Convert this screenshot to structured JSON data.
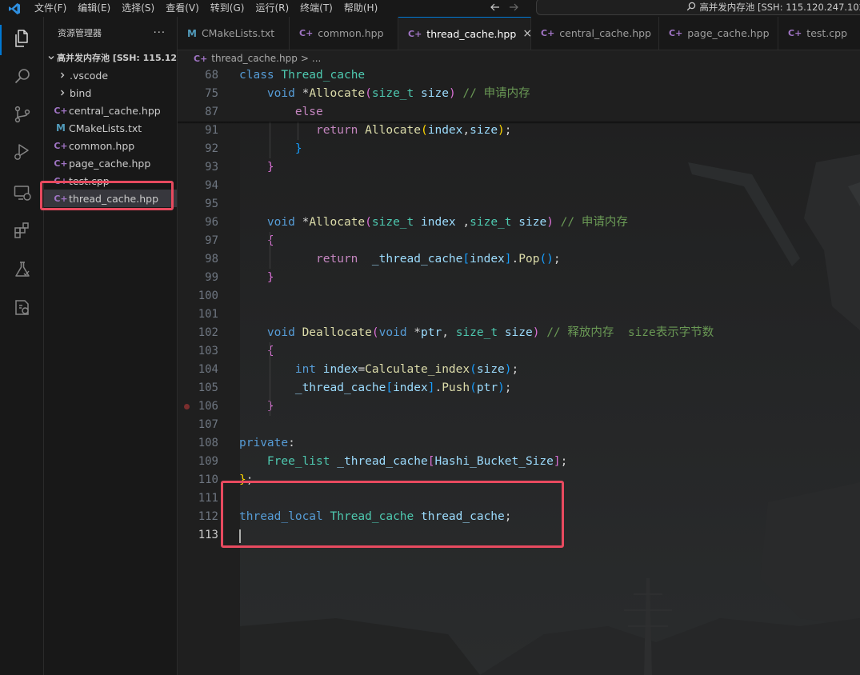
{
  "titlebar": {
    "menu": [
      "文件(F)",
      "编辑(E)",
      "选择(S)",
      "查看(V)",
      "转到(G)",
      "运行(R)",
      "终端(T)",
      "帮助(H)"
    ],
    "command_center": "高并发内存池 [SSH: 115.120.247.102"
  },
  "activity_bar": {
    "icons": [
      "explorer-icon",
      "search-icon",
      "source-control-icon",
      "run-debug-icon",
      "remote-explorer-icon",
      "extensions-icon",
      "testing-icon",
      "cmake-tools-icon"
    ]
  },
  "sidebar": {
    "title": "资源管理器",
    "more": "···",
    "folder": "高并发内存池 [SSH: 115.12...",
    "items": [
      {
        "label": ".vscode",
        "kind": "folder"
      },
      {
        "label": "bind",
        "kind": "folder"
      },
      {
        "label": "central_cache.hpp",
        "kind": "cpp"
      },
      {
        "label": "CMakeLists.txt",
        "kind": "cmake"
      },
      {
        "label": "common.hpp",
        "kind": "cpp"
      },
      {
        "label": "page_cache.hpp",
        "kind": "cpp"
      },
      {
        "label": "test.cpp",
        "kind": "cpp"
      },
      {
        "label": "thread_cache.hpp",
        "kind": "cpp",
        "selected": true
      }
    ]
  },
  "tabs": [
    {
      "label": "CMakeLists.txt",
      "icon": "cmake"
    },
    {
      "label": "common.hpp",
      "icon": "cpp"
    },
    {
      "label": "thread_cache.hpp",
      "icon": "cpp",
      "active": true,
      "close": "×"
    },
    {
      "label": "central_cache.hpp",
      "icon": "cpp"
    },
    {
      "label": "page_cache.hpp",
      "icon": "cpp"
    },
    {
      "label": "test.cpp",
      "icon": "cpp"
    }
  ],
  "breadcrumb": {
    "file": "thread_cache.hpp",
    "separator": ">",
    "rest": "..."
  },
  "editor": {
    "current_line": "113",
    "breakpoint_line": "106",
    "lines": [
      {
        "n": "68",
        "tokens": [
          [
            "kw",
            "class"
          ],
          [
            "pu",
            " "
          ],
          [
            "ty",
            "Thread_cache"
          ]
        ]
      },
      {
        "n": "75",
        "tokens": [
          [
            "pu",
            "    "
          ],
          [
            "kw",
            "void"
          ],
          [
            "pu",
            " *"
          ],
          [
            "fn",
            "Allocate"
          ],
          [
            "br2",
            "("
          ],
          [
            "ty",
            "size_t"
          ],
          [
            "pu",
            " "
          ],
          [
            "va",
            "size"
          ],
          [
            "br2",
            ")"
          ],
          [
            "pu",
            " "
          ],
          [
            "cm",
            "// 申请内存"
          ]
        ]
      },
      {
        "n": "87",
        "tokens": [
          [
            "pu",
            "        "
          ],
          [
            "ct",
            "else"
          ]
        ]
      },
      {
        "n": "91",
        "tokens": [
          [
            "pu",
            "           "
          ],
          [
            "ct",
            "return"
          ],
          [
            "pu",
            " "
          ],
          [
            "fn",
            "Allocate"
          ],
          [
            "br1",
            "("
          ],
          [
            "va",
            "index"
          ],
          [
            "pu",
            ","
          ],
          [
            "va",
            "size"
          ],
          [
            "br1",
            ")"
          ],
          [
            "pu",
            ";"
          ]
        ]
      },
      {
        "n": "92",
        "tokens": [
          [
            "pu",
            "        "
          ],
          [
            "br3",
            "}"
          ]
        ]
      },
      {
        "n": "93",
        "tokens": [
          [
            "pu",
            "    "
          ],
          [
            "br2",
            "}"
          ]
        ]
      },
      {
        "n": "94",
        "tokens": []
      },
      {
        "n": "95",
        "tokens": []
      },
      {
        "n": "96",
        "tokens": [
          [
            "pu",
            "    "
          ],
          [
            "kw",
            "void"
          ],
          [
            "pu",
            " *"
          ],
          [
            "fn",
            "Allocate"
          ],
          [
            "br2",
            "("
          ],
          [
            "ty",
            "size_t"
          ],
          [
            "pu",
            " "
          ],
          [
            "va",
            "index"
          ],
          [
            "pu",
            " ,"
          ],
          [
            "ty",
            "size_t"
          ],
          [
            "pu",
            " "
          ],
          [
            "va",
            "size"
          ],
          [
            "br2",
            ")"
          ],
          [
            "pu",
            " "
          ],
          [
            "cm",
            "// 申请内存"
          ]
        ]
      },
      {
        "n": "97",
        "tokens": [
          [
            "pu",
            "    "
          ],
          [
            "br2",
            "{"
          ]
        ]
      },
      {
        "n": "98",
        "tokens": [
          [
            "pu",
            "           "
          ],
          [
            "ct",
            "return"
          ],
          [
            "pu",
            "  "
          ],
          [
            "va",
            "_thread_cache"
          ],
          [
            "br3",
            "["
          ],
          [
            "va",
            "index"
          ],
          [
            "br3",
            "]"
          ],
          [
            "pu",
            "."
          ],
          [
            "fn",
            "Pop"
          ],
          [
            "br3",
            "()"
          ],
          [
            "pu",
            ";"
          ]
        ]
      },
      {
        "n": "99",
        "tokens": [
          [
            "pu",
            "    "
          ],
          [
            "br2",
            "}"
          ]
        ]
      },
      {
        "n": "100",
        "tokens": []
      },
      {
        "n": "101",
        "tokens": []
      },
      {
        "n": "102",
        "tokens": [
          [
            "pu",
            "    "
          ],
          [
            "kw",
            "void"
          ],
          [
            "pu",
            " "
          ],
          [
            "fn",
            "Deallocate"
          ],
          [
            "br2",
            "("
          ],
          [
            "kw",
            "void"
          ],
          [
            "pu",
            " *"
          ],
          [
            "va",
            "ptr"
          ],
          [
            "pu",
            ", "
          ],
          [
            "ty",
            "size_t"
          ],
          [
            "pu",
            " "
          ],
          [
            "va",
            "size"
          ],
          [
            "br2",
            ")"
          ],
          [
            "pu",
            " "
          ],
          [
            "cm",
            "// 释放内存  size表示字节数"
          ]
        ]
      },
      {
        "n": "103",
        "tokens": [
          [
            "pu",
            "    "
          ],
          [
            "br2",
            "{"
          ]
        ]
      },
      {
        "n": "104",
        "tokens": [
          [
            "pu",
            "        "
          ],
          [
            "kw",
            "int"
          ],
          [
            "pu",
            " "
          ],
          [
            "va",
            "index"
          ],
          [
            "pu",
            "="
          ],
          [
            "fn",
            "Calculate_index"
          ],
          [
            "br3",
            "("
          ],
          [
            "va",
            "size"
          ],
          [
            "br3",
            ")"
          ],
          [
            "pu",
            ";"
          ]
        ]
      },
      {
        "n": "105",
        "tokens": [
          [
            "pu",
            "        "
          ],
          [
            "va",
            "_thread_cache"
          ],
          [
            "br3",
            "["
          ],
          [
            "va",
            "index"
          ],
          [
            "br3",
            "]"
          ],
          [
            "pu",
            "."
          ],
          [
            "fn",
            "Push"
          ],
          [
            "br3",
            "("
          ],
          [
            "va",
            "ptr"
          ],
          [
            "br3",
            ")"
          ],
          [
            "pu",
            ";"
          ]
        ]
      },
      {
        "n": "106",
        "tokens": [
          [
            "pu",
            "    "
          ],
          [
            "br2",
            "}"
          ]
        ]
      },
      {
        "n": "107",
        "tokens": []
      },
      {
        "n": "108",
        "tokens": [
          [
            "kw",
            "private"
          ],
          [
            "pu",
            ":"
          ]
        ]
      },
      {
        "n": "109",
        "tokens": [
          [
            "pu",
            "    "
          ],
          [
            "ty",
            "Free_list"
          ],
          [
            "pu",
            " "
          ],
          [
            "va",
            "_thread_cache"
          ],
          [
            "br2",
            "["
          ],
          [
            "va",
            "Hashi_Bucket_Size"
          ],
          [
            "br2",
            "]"
          ],
          [
            "pu",
            ";"
          ]
        ]
      },
      {
        "n": "110",
        "tokens": [
          [
            "br1",
            "}"
          ],
          [
            "pu",
            ";"
          ]
        ]
      },
      {
        "n": "111",
        "tokens": []
      },
      {
        "n": "112",
        "tokens": [
          [
            "kw",
            "thread_local"
          ],
          [
            "pu",
            " "
          ],
          [
            "ty",
            "Thread_cache"
          ],
          [
            "pu",
            " "
          ],
          [
            "va",
            "thread_cache"
          ],
          [
            "pu",
            ";"
          ]
        ]
      },
      {
        "n": "113",
        "tokens": []
      }
    ]
  },
  "colors": {
    "accent": "#0078d4",
    "highlight_box": "#e84a5f",
    "cpp_icon": "#a074c4",
    "cmake_icon": "#519aba"
  }
}
